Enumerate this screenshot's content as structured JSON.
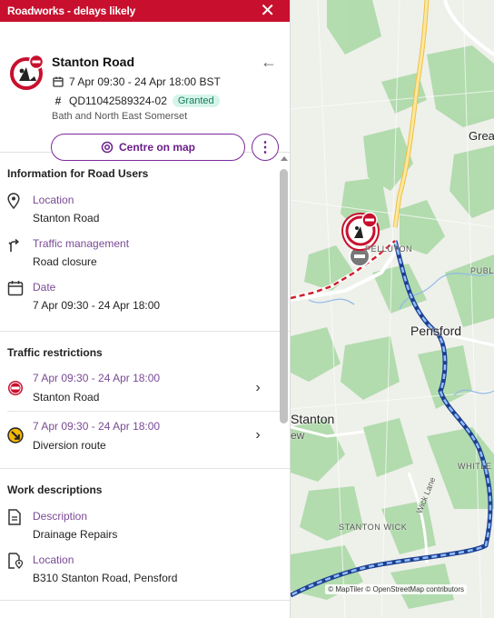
{
  "header": {
    "title": "Roadworks - delays likely",
    "close_icon": "close-icon"
  },
  "summary": {
    "road_name": "Stanton Road",
    "date_range": "7 Apr 09:30 - 24 Apr 18:00 BST",
    "reference": "QD11042589324-02",
    "status": "Granted",
    "council": "Bath and North East Somerset",
    "centre_button": "Centre on map",
    "more_icon": "more-vertical-icon",
    "back_icon": "arrow-left-icon"
  },
  "info": {
    "title": "Information for Road Users",
    "items": [
      {
        "label": "Location",
        "value": "Stanton Road",
        "icon": "location-pin-icon"
      },
      {
        "label": "Traffic management",
        "value": "Road closure",
        "icon": "traffic-management-icon"
      },
      {
        "label": "Date",
        "value": "7 Apr 09:30 - 24 Apr 18:00",
        "icon": "calendar-icon"
      }
    ]
  },
  "restrictions": {
    "title": "Traffic restrictions",
    "items": [
      {
        "date": "7 Apr 09:30 - 24 Apr 18:00",
        "value": "Stanton Road",
        "icon": "no-entry-icon"
      },
      {
        "date": "7 Apr 09:30 - 24 Apr 18:00",
        "value": "Diversion route",
        "icon": "diversion-icon"
      }
    ]
  },
  "works": {
    "title": "Work descriptions",
    "items": [
      {
        "label": "Description",
        "value": "Drainage Repairs",
        "icon": "document-icon"
      },
      {
        "label": "Location",
        "value": "B310 Stanton Road, Pensford",
        "icon": "document-location-icon"
      }
    ]
  },
  "map": {
    "labels": [
      "Great",
      "PELLUTON",
      "PUBLI",
      "Pensford",
      "Stanton",
      "Wick Lane",
      "WHITLE",
      "STANTON WICK",
      "ew"
    ],
    "attribution": "© MapTiler © OpenStreetMap contributors"
  },
  "colors": {
    "header_red": "#c8102e",
    "accent_purple": "#7b2a9b",
    "granted_bg": "#d6f5ea",
    "granted_text": "#157d5b",
    "label_purple": "#7a4a96",
    "diversion_blue": "#2a6fd6",
    "closure_red": "#d0202e"
  }
}
